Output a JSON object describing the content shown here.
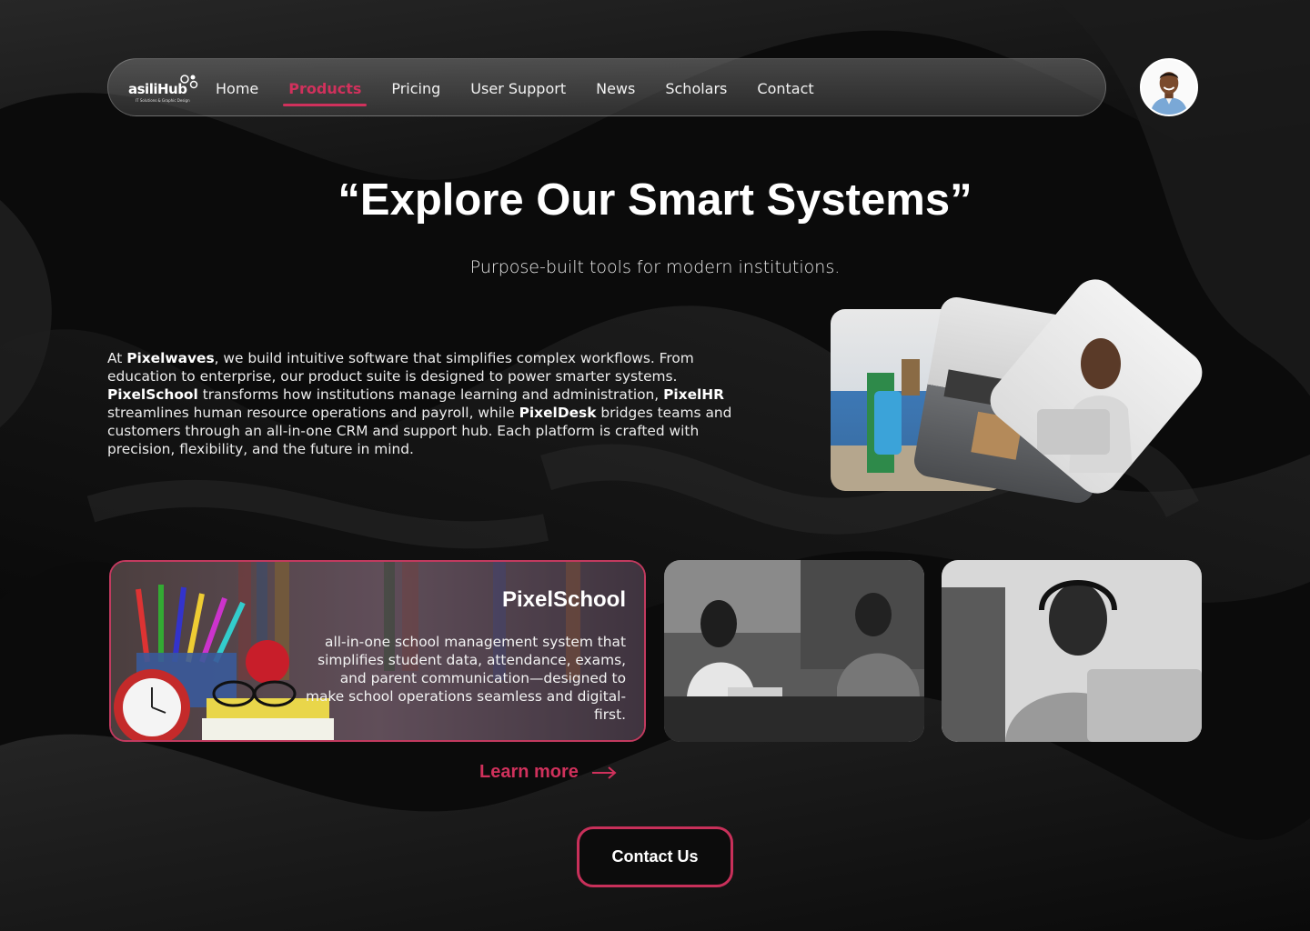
{
  "brand": {
    "name": "asiliHub",
    "tagline": "IT Solutions & Graphic Design"
  },
  "nav": {
    "items": [
      {
        "label": "Home",
        "active": false
      },
      {
        "label": "Products",
        "active": true
      },
      {
        "label": "Pricing",
        "active": false
      },
      {
        "label": "User Support",
        "active": false
      },
      {
        "label": "News",
        "active": false
      },
      {
        "label": "Scholars",
        "active": false
      },
      {
        "label": "Contact",
        "active": false
      }
    ]
  },
  "hero": {
    "title": "“Explore Our Smart Systems”",
    "subtitle": "Purpose-built tools for modern institutions."
  },
  "intro": {
    "p1": "At ",
    "company": "Pixelwaves",
    "p2": ", we build intuitive software that simplifies complex workflows. From education to enterprise, our product suite is designed to power smarter systems. ",
    "product1": "PixelSchool",
    "p3": " transforms how institutions manage learning and administration, ",
    "product2": "PixelHR",
    "p4": " streamlines human resource operations and payroll, while ",
    "product3": "PixelDesk",
    "p5": " bridges teams and customers through an all-in-one CRM and support hub. Each platform is crafted with precision, flexibility, and the future in mind."
  },
  "featured_card": {
    "title": "PixelSchool",
    "description": "all-in-one school management system that simplifies student data, attendance, exams, and parent communication—designed to make school operations seamless and digital-first."
  },
  "learn_more": "Learn more",
  "contact_button": "Contact Us",
  "colors": {
    "accent": "#d0315c",
    "background": "#0a0a0a",
    "text": "#ffffff"
  }
}
